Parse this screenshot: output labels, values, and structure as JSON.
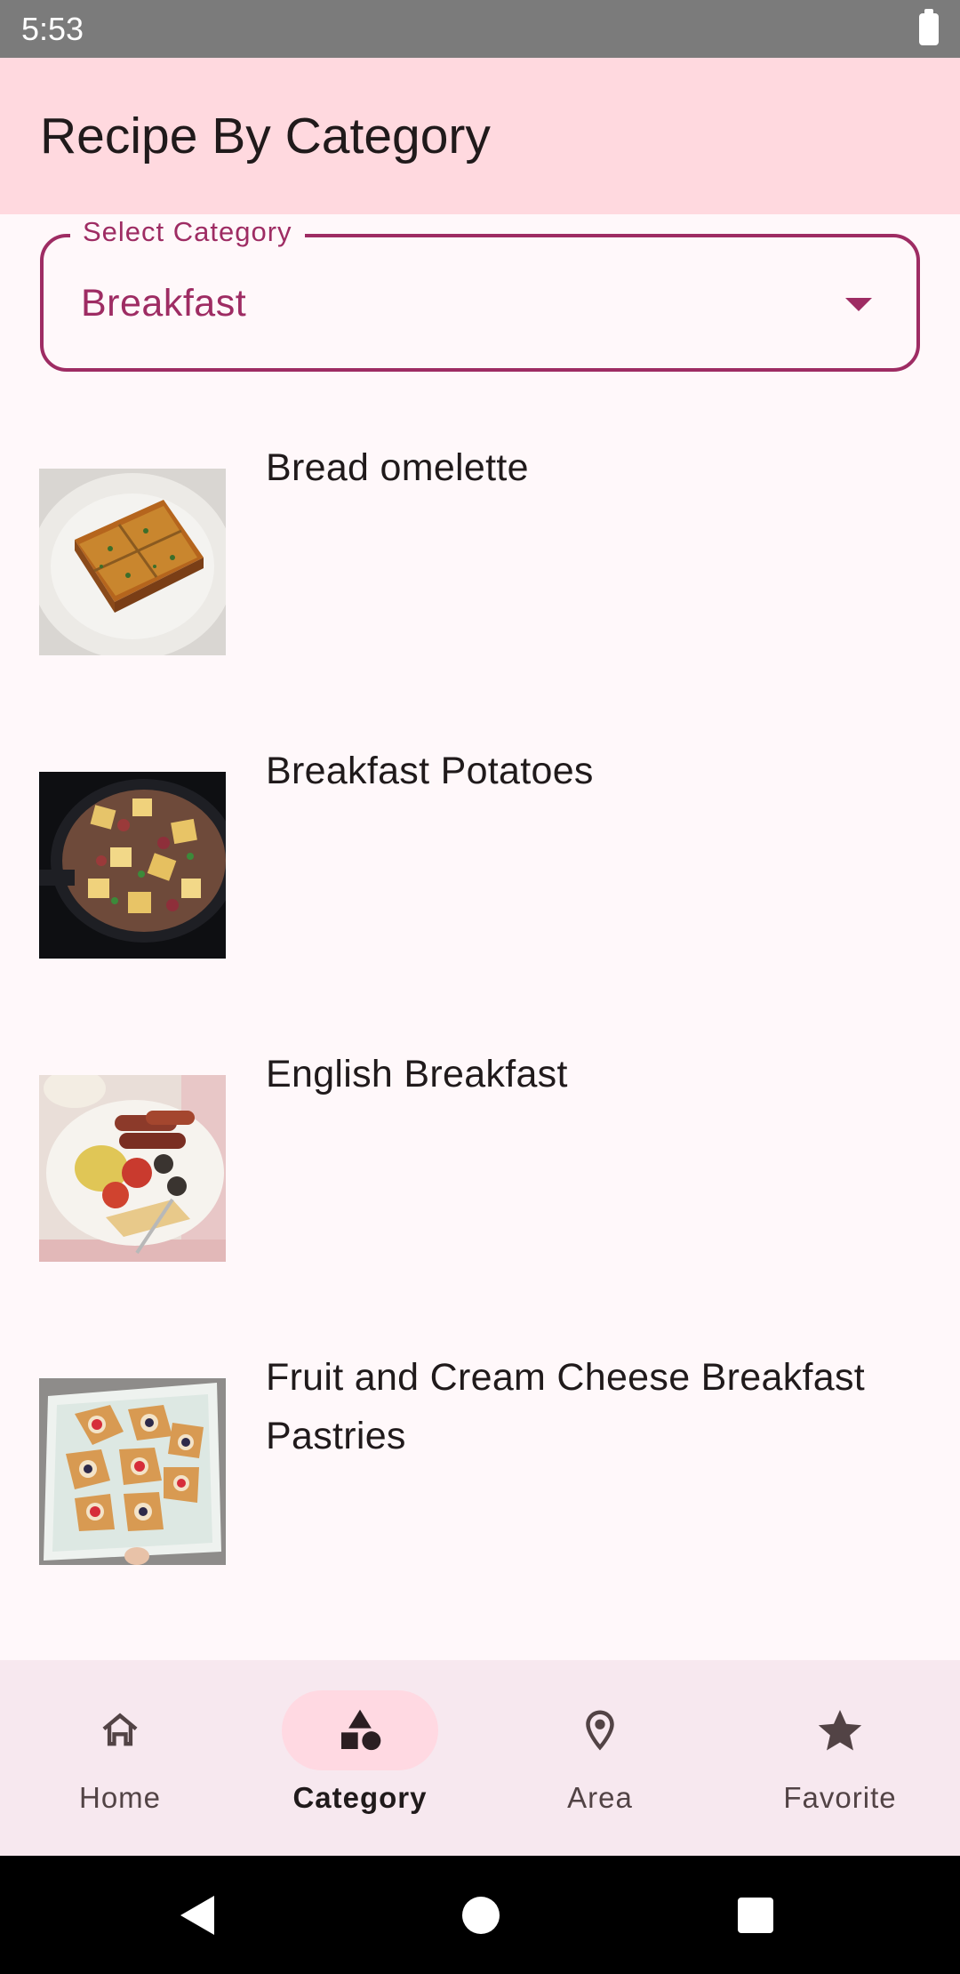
{
  "status_bar": {
    "time": "5:53"
  },
  "app_bar": {
    "title": "Recipe By Category"
  },
  "category_select": {
    "label": "Select Category",
    "value": "Breakfast"
  },
  "recipes": [
    {
      "title": "Bread omelette"
    },
    {
      "title": "Breakfast Potatoes"
    },
    {
      "title": "English Breakfast"
    },
    {
      "title": "Fruit and Cream Cheese Breakfast Pastries"
    }
  ],
  "bottom_nav": {
    "items": [
      {
        "label": "Home",
        "icon": "home-icon",
        "active": false
      },
      {
        "label": "Category",
        "icon": "category-icon",
        "active": true
      },
      {
        "label": "Area",
        "icon": "location-pin-icon",
        "active": false
      },
      {
        "label": "Favorite",
        "icon": "star-icon",
        "active": false
      }
    ]
  },
  "colors": {
    "primary": "#9E2C63",
    "app_bar_bg": "#FFD9DF",
    "nav_bg": "#F7E8EF",
    "active_pill": "#FFD9E2"
  }
}
